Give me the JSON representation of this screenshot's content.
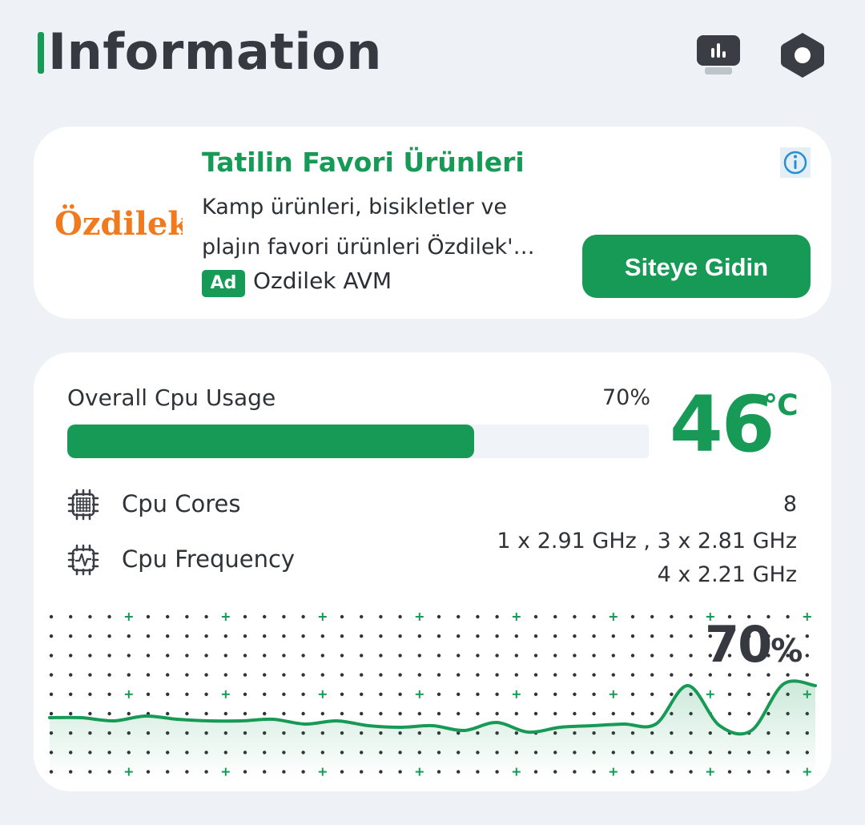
{
  "header": {
    "title": "Information",
    "icons": {
      "monitor": "monitor-chart-icon",
      "settings": "hexagon-settings-icon"
    }
  },
  "ad": {
    "logo_text": "Özdilek",
    "title": "Tatilin Favori Ürünleri",
    "body_line1": "Kamp ürünleri, bisikletler ve",
    "body_line2": "plajın favori ürünleri Özdilek'…",
    "badge": "Ad",
    "advertiser": "Ozdilek AVM",
    "cta_label": "Siteye Gidin",
    "info_icon": "info-icon"
  },
  "cpu": {
    "usage_label": "Overall Cpu Usage",
    "usage_percent_text": "70%",
    "usage_fraction": 0.7,
    "temperature": "46",
    "temperature_unit": "℃",
    "cores_label": "Cpu Cores",
    "cores_value": "8",
    "frequency_label": "Cpu Frequency",
    "frequency_line1": "1 x 2.91 GHz , 3 x 2.81 GHz",
    "frequency_line2": "4 x 2.21 GHz",
    "graph_current_value": "70",
    "graph_current_unit": "%",
    "history": [
      52,
      52,
      50,
      53,
      51,
      50,
      50,
      51,
      48,
      50,
      47,
      46,
      47,
      44,
      49,
      43,
      46,
      47,
      48,
      48,
      72,
      47,
      44,
      73,
      72
    ]
  },
  "colors": {
    "accent": "#179a55",
    "background": "#eef2f7",
    "card": "#ffffff",
    "text": "#2f3237"
  }
}
